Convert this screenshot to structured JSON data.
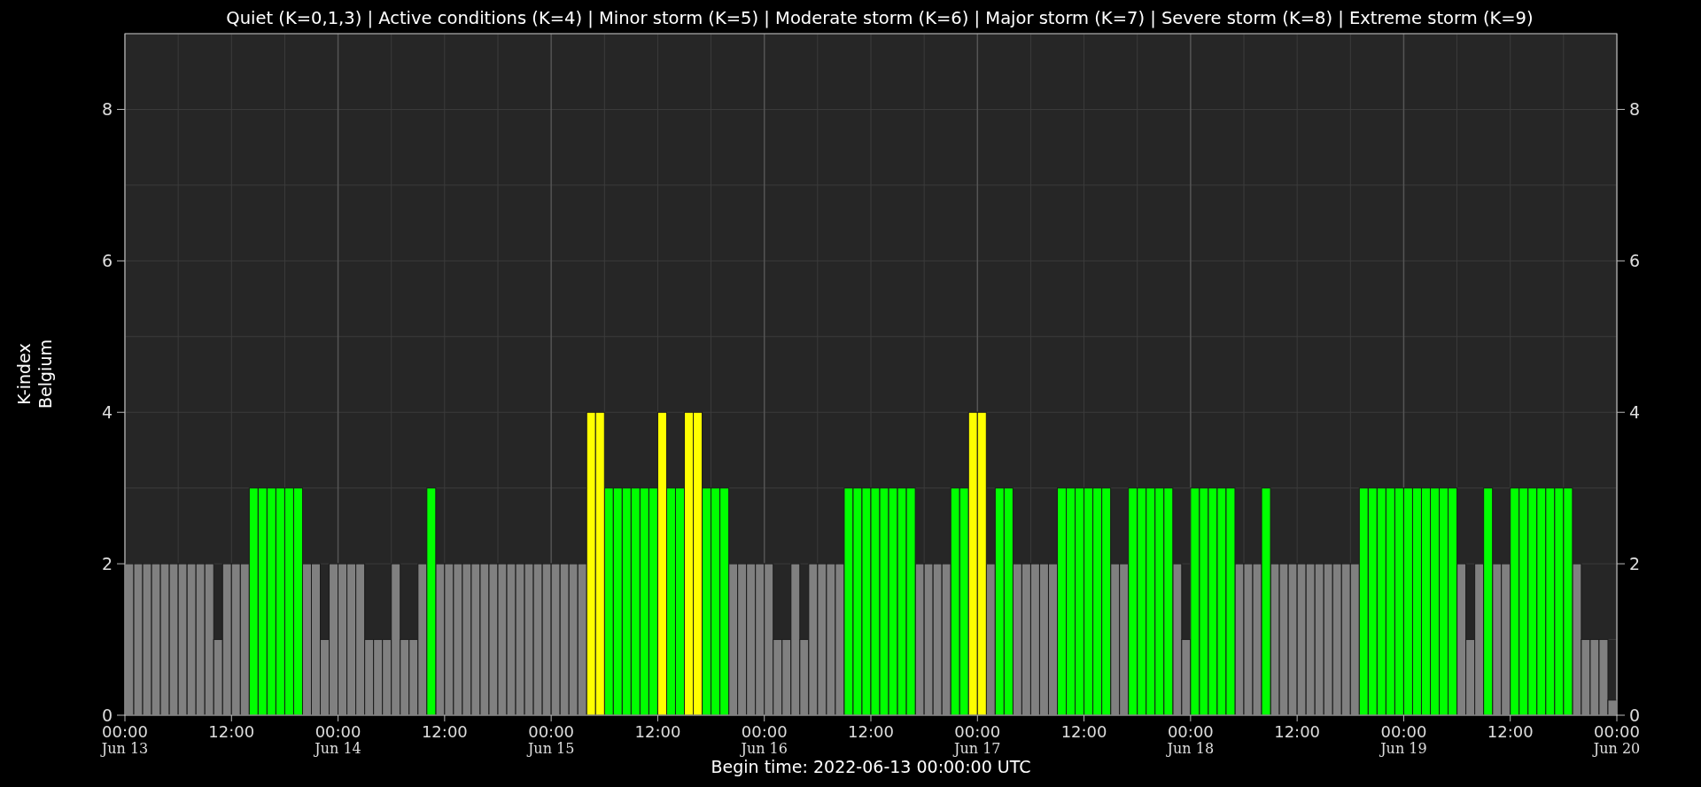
{
  "chart_data": {
    "type": "bar",
    "title": "Quiet (K=0,1,3) | Active conditions (K=4) | Minor storm (K=5) | Moderate storm (K=6) | Major storm (K=7) | Severe storm (K=8) | Extreme storm (K=9)",
    "xlabel": "Begin time: 2022-06-13 00:00:00 UTC",
    "ylabel": "K-index\nBelgium",
    "grid": true,
    "ylim": [
      0,
      9
    ],
    "y2lim": [
      0,
      9
    ],
    "yticks": [
      0,
      2,
      4,
      6,
      8
    ],
    "y2ticks": [
      0,
      2,
      4,
      6,
      8
    ],
    "categories": [
      "00:00\nJun 13",
      null,
      null,
      null,
      null,
      null,
      null,
      null,
      null,
      null,
      null,
      null,
      "12:00",
      null,
      null,
      null,
      null,
      null,
      null,
      null,
      null,
      null,
      null,
      null,
      "00:00\nJun 14",
      null,
      null,
      null,
      null,
      null,
      null,
      null,
      null,
      null,
      null,
      null,
      "12:00",
      null,
      null,
      null,
      null,
      null,
      null,
      null,
      null,
      null,
      null,
      null,
      "00:00\nJun 15",
      null,
      null,
      null,
      null,
      null,
      null,
      null,
      null,
      null,
      null,
      null,
      "12:00",
      null,
      null,
      null,
      null,
      null,
      null,
      null,
      null,
      null,
      null,
      null,
      "00:00\nJun 16",
      null,
      null,
      null,
      null,
      null,
      null,
      null,
      null,
      null,
      null,
      null,
      "12:00",
      null,
      null,
      null,
      null,
      null,
      null,
      null,
      null,
      null,
      null,
      null,
      "00:00\nJun 17",
      null,
      null,
      null,
      null,
      null,
      null,
      null,
      null,
      null,
      null,
      null,
      "12:00",
      null,
      null,
      null,
      null,
      null,
      null,
      null,
      null,
      null,
      null,
      null,
      "00:00\nJun 18",
      null,
      null,
      null,
      null,
      null,
      null,
      null,
      null,
      null,
      null,
      null,
      "12:00",
      null,
      null,
      null,
      null,
      null,
      null,
      null,
      null,
      null,
      null,
      null,
      "00:00\nJun 19",
      null,
      null,
      null,
      null,
      null,
      null,
      null,
      null,
      null,
      null,
      null,
      "12:00",
      null,
      null,
      null,
      null,
      null,
      null,
      null,
      null,
      null,
      null,
      null
    ],
    "annotations": [
      {
        "text": "00:00\nJun 20"
      }
    ],
    "series": [
      {
        "color": "#808080",
        "values": [
          2,
          2,
          2,
          2,
          2,
          2,
          2,
          2,
          2,
          2,
          1,
          2,
          2,
          2,
          null,
          null,
          null,
          null,
          null,
          null,
          2,
          2,
          1,
          2,
          2,
          2,
          2,
          1,
          1,
          1,
          2,
          1,
          1,
          2,
          null,
          2,
          2,
          2,
          2,
          2,
          2,
          2,
          2,
          2,
          2,
          2,
          2,
          2,
          2,
          2,
          2,
          2,
          null,
          null,
          null,
          null,
          null,
          null,
          null,
          null,
          null,
          null,
          null,
          null,
          null,
          null,
          null,
          null,
          2,
          2,
          2,
          2,
          2,
          1,
          1,
          2,
          1,
          2,
          2,
          2,
          2,
          null,
          null,
          null,
          null,
          null,
          null,
          null,
          null,
          2,
          2,
          2,
          2,
          null,
          null,
          null,
          null,
          2,
          null,
          null,
          2,
          2,
          2,
          2,
          2,
          null,
          null,
          null,
          null,
          null,
          null,
          2,
          2,
          null,
          null,
          null,
          null,
          null,
          2,
          1,
          null,
          null,
          null,
          null,
          null,
          2,
          2,
          2,
          null,
          2,
          2,
          2,
          2,
          2,
          2,
          2,
          2,
          2,
          2,
          null,
          null,
          null,
          null,
          null,
          null,
          null,
          null,
          null,
          null,
          null,
          2,
          1,
          2,
          null,
          2,
          2,
          null,
          null,
          null,
          null,
          null,
          null,
          null,
          2,
          1,
          1,
          1,
          0.2
        ]
      },
      {
        "color": "#00ff00",
        "values": [
          null,
          null,
          null,
          null,
          null,
          null,
          null,
          null,
          null,
          null,
          null,
          null,
          null,
          null,
          3,
          3,
          3,
          3,
          3,
          3,
          null,
          null,
          null,
          null,
          null,
          null,
          null,
          null,
          null,
          null,
          null,
          null,
          null,
          null,
          3,
          null,
          null,
          null,
          null,
          null,
          null,
          null,
          null,
          null,
          null,
          null,
          null,
          null,
          null,
          null,
          null,
          null,
          null,
          null,
          3,
          3,
          3,
          3,
          3,
          3,
          null,
          3,
          3,
          null,
          null,
          3,
          3,
          3,
          null,
          null,
          null,
          null,
          null,
          null,
          null,
          null,
          null,
          null,
          null,
          null,
          null,
          3,
          3,
          3,
          3,
          3,
          3,
          3,
          3,
          null,
          null,
          null,
          null,
          3,
          3,
          null,
          null,
          null,
          3,
          3,
          null,
          null,
          null,
          null,
          null,
          3,
          3,
          3,
          3,
          3,
          3,
          null,
          null,
          3,
          3,
          3,
          3,
          3,
          null,
          null,
          3,
          3,
          3,
          3,
          3,
          null,
          null,
          null,
          3,
          null,
          null,
          null,
          null,
          null,
          null,
          null,
          null,
          null,
          null,
          3,
          3,
          3,
          3,
          3,
          3,
          3,
          3,
          3,
          3,
          3,
          null,
          null,
          null,
          3,
          null,
          null,
          3,
          3,
          3,
          3,
          3,
          3,
          3,
          null,
          null,
          null,
          null,
          null
        ]
      },
      {
        "color": "#ffff00",
        "values": [
          null,
          null,
          null,
          null,
          null,
          null,
          null,
          null,
          null,
          null,
          null,
          null,
          null,
          null,
          null,
          null,
          null,
          null,
          null,
          null,
          null,
          null,
          null,
          null,
          null,
          null,
          null,
          null,
          null,
          null,
          null,
          null,
          null,
          null,
          null,
          null,
          null,
          null,
          null,
          null,
          null,
          null,
          null,
          null,
          null,
          null,
          null,
          null,
          null,
          null,
          null,
          null,
          4,
          4,
          null,
          null,
          null,
          null,
          null,
          null,
          4,
          null,
          null,
          4,
          4,
          null,
          null,
          null,
          null,
          null,
          null,
          null,
          null,
          null,
          null,
          null,
          null,
          null,
          null,
          null,
          null,
          null,
          null,
          null,
          null,
          null,
          null,
          null,
          null,
          null,
          null,
          null,
          null,
          null,
          null,
          4,
          4,
          null,
          null,
          null,
          null,
          null,
          null,
          null,
          null,
          null,
          null,
          null,
          null,
          null,
          null,
          null,
          null,
          null,
          null,
          null,
          null,
          null,
          null,
          null,
          null,
          null,
          null,
          null,
          null,
          null,
          null,
          null,
          null,
          null,
          null,
          null,
          null,
          null,
          null,
          null,
          null,
          null,
          null,
          null,
          null,
          null,
          null,
          null,
          null,
          null,
          null,
          null,
          null,
          null,
          null,
          null,
          null,
          null,
          null,
          null,
          null,
          null,
          null,
          null,
          null,
          null,
          null,
          null,
          null,
          null,
          null,
          null
        ]
      }
    ]
  }
}
